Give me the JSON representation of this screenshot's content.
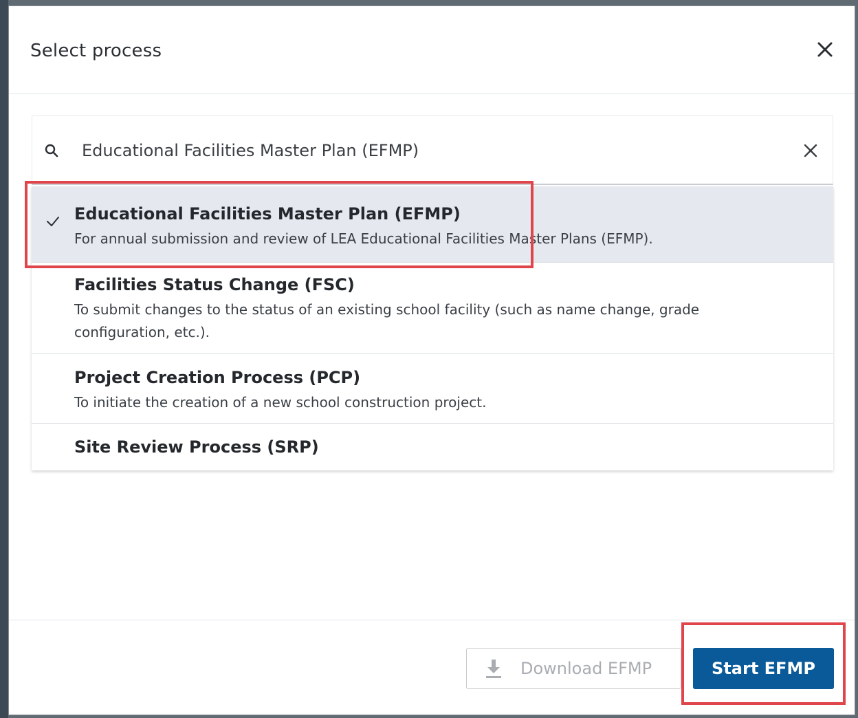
{
  "dialog": {
    "title": "Select process"
  },
  "search": {
    "value": "Educational Facilities Master Plan (EFMP)"
  },
  "processes": [
    {
      "title": "Educational Facilities Master Plan (EFMP)",
      "description": "For annual submission and review of LEA Educational Facilities Master Plans (EFMP).",
      "selected": true
    },
    {
      "title": "Facilities Status Change (FSC)",
      "description": "To submit changes to the status of an existing school facility (such as name change, grade configuration, etc.).",
      "selected": false
    },
    {
      "title": "Project Creation Process (PCP)",
      "description": "To initiate the creation of a new school construction project.",
      "selected": false
    },
    {
      "title": "Site Review Process (SRP)",
      "description": "",
      "selected": false
    }
  ],
  "footer": {
    "download_label": "Download EFMP",
    "start_label": "Start EFMP"
  },
  "colors": {
    "primary": "#0a5a9a",
    "highlight": "#e0454b",
    "selected_row": "#e6e8ef"
  }
}
